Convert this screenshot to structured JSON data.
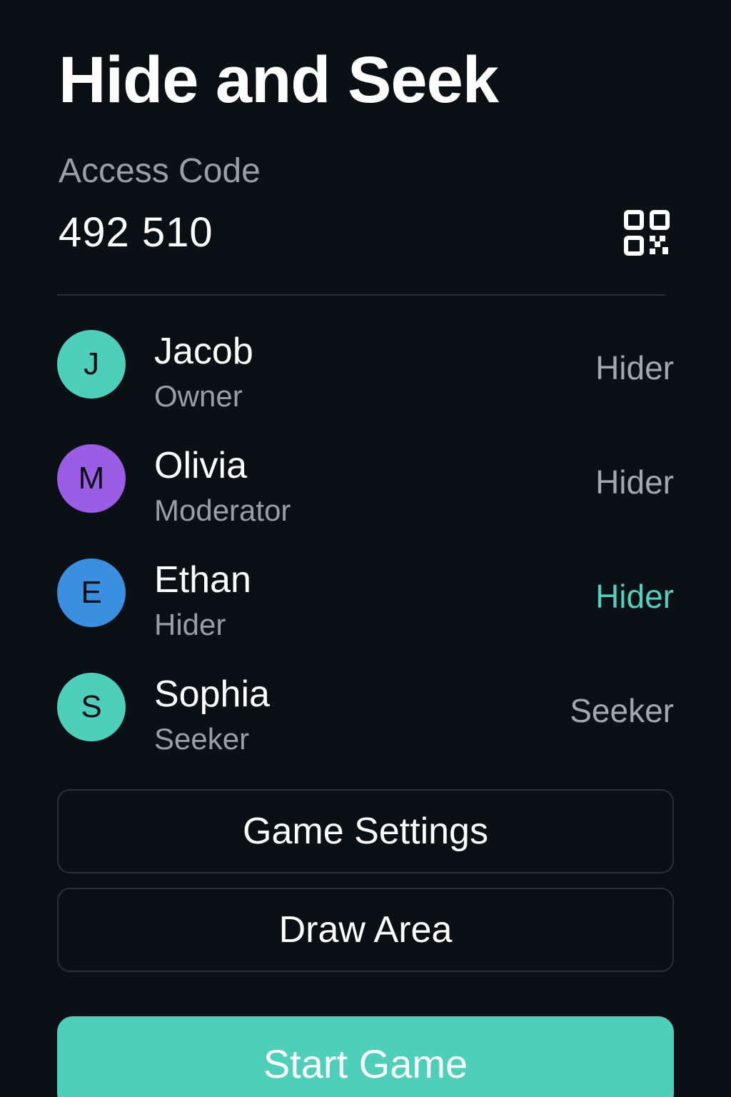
{
  "header": {
    "title": "Hide and Seek"
  },
  "access": {
    "label": "Access Code",
    "code": "492 510",
    "qr_icon": "qr-code-icon"
  },
  "players": [
    {
      "initial": "J",
      "name": "Jacob",
      "role": "Owner",
      "team": "Hider",
      "avatar_color": "#4ecfb9",
      "highlighted": false
    },
    {
      "initial": "M",
      "name": "Olivia",
      "role": "Moderator",
      "team": "Hider",
      "avatar_color": "#9b5de5",
      "highlighted": false
    },
    {
      "initial": "E",
      "name": "Ethan",
      "role": "Hider",
      "team": "Hider",
      "avatar_color": "#3b8fe0",
      "highlighted": true
    },
    {
      "initial": "S",
      "name": "Sophia",
      "role": "Seeker",
      "team": "Seeker",
      "avatar_color": "#4ecfb9",
      "highlighted": false
    }
  ],
  "actions": {
    "game_settings_label": "Game Settings",
    "draw_area_label": "Draw Area",
    "start_game_label": "Start Game"
  },
  "colors": {
    "background": "#0b1014",
    "accent": "#4ecfb9",
    "muted_text": "#9a9fa5"
  }
}
